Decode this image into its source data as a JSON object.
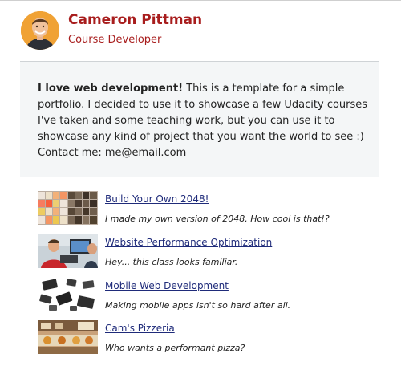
{
  "header": {
    "name": "Cameron Pittman",
    "role": "Course Developer"
  },
  "bio": {
    "lead": "I love web development!",
    "text": " This is a template for a simple portfolio. I decided to use it to showcase a few Udacity courses I've taken and some teaching work, but you can use it to showcase any kind of project that you want the world to see :)",
    "contact": "Contact me: me@email.com"
  },
  "projects": [
    {
      "title": "Build Your Own 2048!",
      "description": "I made my own version of 2048. How cool is that!?",
      "icon": "2048-grid-thumbnail"
    },
    {
      "title": "Website Performance Optimization",
      "description": "Hey... this class looks familiar.",
      "icon": "instructors-thumbnail"
    },
    {
      "title": "Mobile Web Development",
      "description": "Making mobile apps isn't so hard after all.",
      "icon": "mobile-devices-thumbnail"
    },
    {
      "title": "Cam's Pizzeria",
      "description": "Who wants a performant pizza?",
      "icon": "pizzeria-thumbnail"
    }
  ],
  "colors": {
    "name": "#a81d1d",
    "link": "#1f2b7a",
    "bio_bg": "#f4f6f7"
  }
}
